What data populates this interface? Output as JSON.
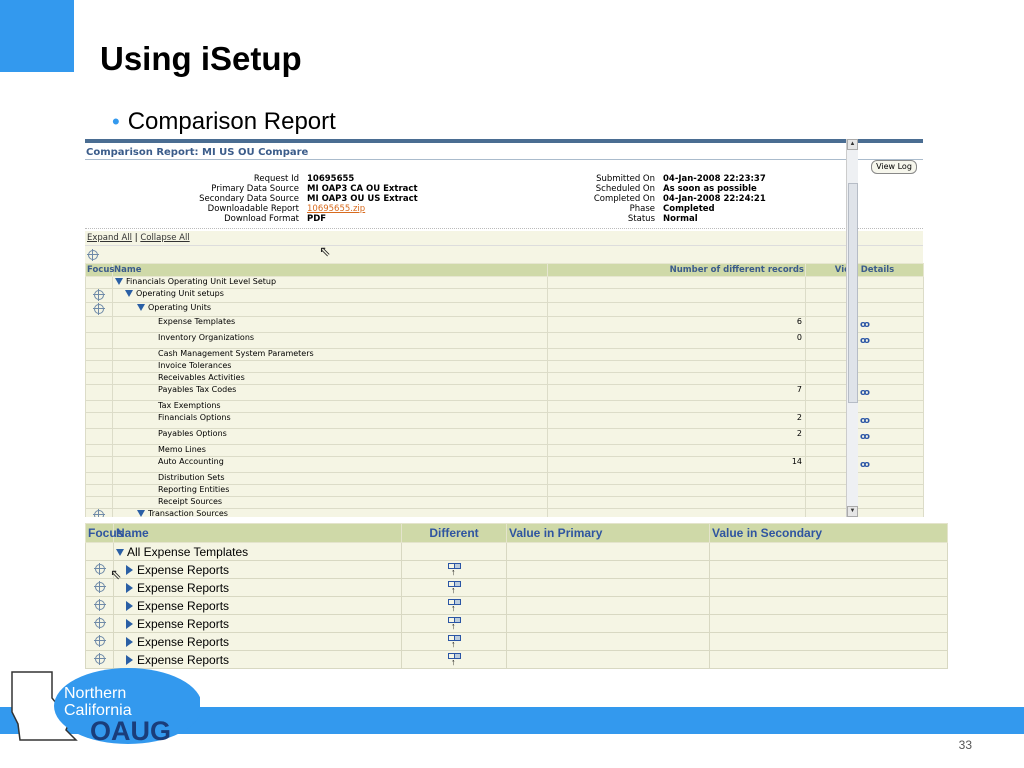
{
  "slide": {
    "title": "Using iSetup",
    "bullet": "Comparison Report",
    "page_number": "33"
  },
  "report": {
    "title": "Comparison Report: MI US OU Compare",
    "view_log": "View Log",
    "left_fields": [
      {
        "label": "Request Id",
        "value": "10695655"
      },
      {
        "label": "Primary Data Source",
        "value": "MI OAP3 CA OU Extract"
      },
      {
        "label": "Secondary Data Source",
        "value": "MI OAP3 OU US Extract"
      },
      {
        "label": "Downloadable Report",
        "value": "10695655.zip"
      },
      {
        "label": "Download Format",
        "value": "PDF"
      }
    ],
    "right_fields": [
      {
        "label": "Submitted On",
        "value": "04-Jan-2008 22:23:37"
      },
      {
        "label": "Scheduled On",
        "value": "As soon as possible"
      },
      {
        "label": "Completed On",
        "value": "04-Jan-2008 22:24:21"
      },
      {
        "label": "Phase",
        "value": "Completed"
      },
      {
        "label": "Status",
        "value": "Normal"
      }
    ],
    "expand_all": "Expand All",
    "separator": "|",
    "collapse_all": "Collapse All",
    "columns": {
      "focus": "Focus",
      "name": "Name",
      "count": "Number of different records",
      "details": "View Details"
    },
    "rows": [
      {
        "name": "Financials Operating Unit Level Setup",
        "level": 0,
        "expanded": true,
        "focus": false,
        "count": "",
        "details": false
      },
      {
        "name": "Operating Unit setups",
        "level": 1,
        "expanded": true,
        "focus": true,
        "count": "",
        "details": false
      },
      {
        "name": "Operating Units",
        "level": 2,
        "expanded": true,
        "focus": true,
        "count": "",
        "details": false
      },
      {
        "name": "Expense Templates",
        "level": 3,
        "focus": false,
        "count": "6",
        "details": true
      },
      {
        "name": "Inventory Organizations",
        "level": 3,
        "focus": false,
        "count": "0",
        "details": true
      },
      {
        "name": "Cash Management System Parameters",
        "level": 3,
        "focus": false,
        "count": "",
        "details": false
      },
      {
        "name": "Invoice Tolerances",
        "level": 3,
        "focus": false,
        "count": "",
        "details": false
      },
      {
        "name": "Receivables Activities",
        "level": 3,
        "focus": false,
        "count": "",
        "details": false
      },
      {
        "name": "Payables Tax Codes",
        "level": 3,
        "focus": false,
        "count": "7",
        "details": true
      },
      {
        "name": "Tax Exemptions",
        "level": 3,
        "focus": false,
        "count": "",
        "details": false
      },
      {
        "name": "Financials Options",
        "level": 3,
        "focus": false,
        "count": "2",
        "details": true
      },
      {
        "name": "Payables Options",
        "level": 3,
        "focus": false,
        "count": "2",
        "details": true
      },
      {
        "name": "Memo Lines",
        "level": 3,
        "focus": false,
        "count": "",
        "details": false
      },
      {
        "name": "Auto Accounting",
        "level": 3,
        "focus": false,
        "count": "14",
        "details": true
      },
      {
        "name": "Distribution Sets",
        "level": 3,
        "focus": false,
        "count": "",
        "details": false
      },
      {
        "name": "Reporting Entities",
        "level": 3,
        "focus": false,
        "count": "",
        "details": false
      },
      {
        "name": "Receipt Sources",
        "level": 3,
        "focus": false,
        "count": "",
        "details": false
      },
      {
        "name": "Transaction Sources",
        "level": 2,
        "expanded": true,
        "focus": true,
        "count": "",
        "details": false
      }
    ]
  },
  "comparison": {
    "columns": {
      "focus": "Focus",
      "name": "Name",
      "different": "Different",
      "primary": "Value in Primary",
      "secondary": "Value in Secondary"
    },
    "group": "All Expense Templates",
    "rows": [
      {
        "name": "Expense Reports"
      },
      {
        "name": "Expense Reports"
      },
      {
        "name": "Expense Reports"
      },
      {
        "name": "Expense Reports"
      },
      {
        "name": "Expense Reports"
      },
      {
        "name": "Expense Reports"
      }
    ]
  },
  "logo": {
    "line1": "Northern",
    "line2": "California",
    "line3": "OAUG"
  },
  "colors": {
    "accent": "#3399ee",
    "header_bg": "#cfd9a8",
    "row_bg": "#f5f5e4",
    "link": "#d86b1e",
    "title_blue": "#3b5c8a"
  }
}
